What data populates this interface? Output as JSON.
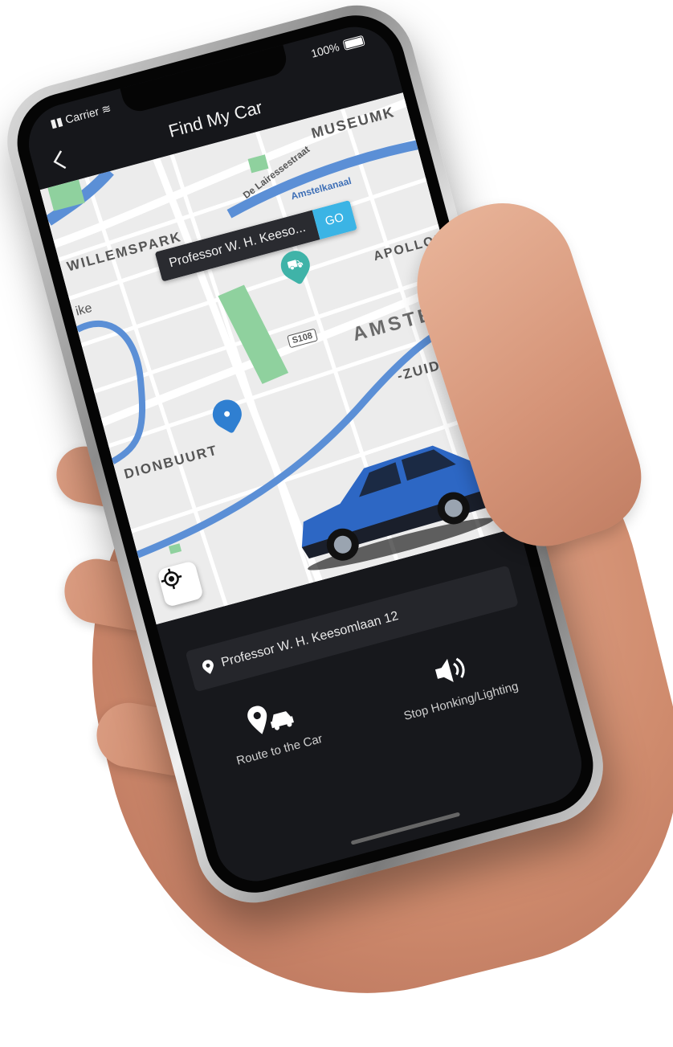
{
  "status_bar": {
    "carrier": "Carrier",
    "battery": "100%"
  },
  "header": {
    "title": "Find My Car"
  },
  "map": {
    "search_text": "Professor W. H. Keeso...",
    "go_label": "GO",
    "labels": {
      "museum": "MUSEUMK",
      "lairesse": "De Lairessestraat",
      "amstelkanaal": "Amstelkanaal",
      "willemspark": "WILLEMSPARK",
      "ike": "ike",
      "apollo": "APOLLOBU",
      "road": "S108",
      "amsterdam": "AMSTERDA",
      "stadion": "DIONBUURT",
      "zuid": "-ZUID"
    }
  },
  "panel": {
    "address": "Professor W. H. Keesomlaan 12",
    "route_label": "Route to the Car",
    "honk_label": "Stop Honking/Lighting"
  },
  "colors": {
    "accent": "#3bb4e5",
    "car_pin": "#3fb3a8",
    "user_pin": "#2f7fd1",
    "park": "#8fd19e",
    "water": "#5b8fd6"
  }
}
